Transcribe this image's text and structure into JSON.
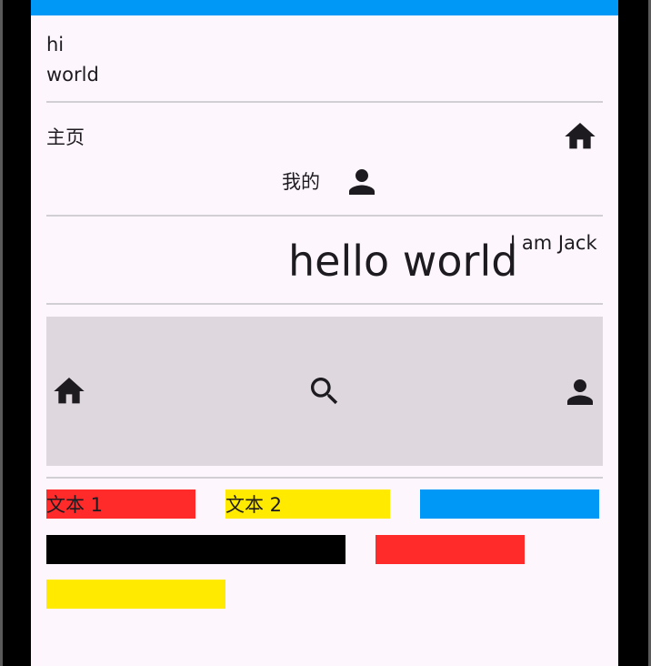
{
  "lines": {
    "line1": "hi",
    "line2": "world"
  },
  "row_home": {
    "label": "主页",
    "icon": "home-icon"
  },
  "row_mine": {
    "label": "我的",
    "icon": "person-icon"
  },
  "headline": {
    "main": "hello world",
    "sub": "I am Jack"
  },
  "bottom_bar": {
    "icons": [
      "home-icon",
      "search-icon",
      "person-icon"
    ],
    "background": "#ded8de"
  },
  "wrap": {
    "boxes": [
      {
        "label": "文本 1",
        "color": "#ff2a2a"
      },
      {
        "label": "文本 2",
        "color": "#ffea00"
      },
      {
        "label": "",
        "color": "#0098f7"
      },
      {
        "label": "",
        "color": "#000000"
      },
      {
        "label": "",
        "color": "#ff2a2a"
      },
      {
        "label": "",
        "color": "#ffea00"
      }
    ]
  },
  "colors": {
    "app_bar": "#0098f7",
    "background": "#fdf7fd",
    "divider": "#d2cfd4"
  }
}
